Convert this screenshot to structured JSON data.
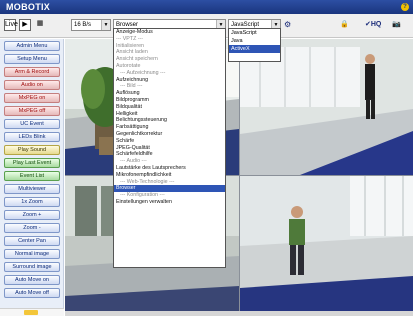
{
  "app": {
    "brand": "MOBOTIX",
    "help_icon": "help-icon",
    "help_glyph": "?"
  },
  "toolbar": {
    "live_label": "Live",
    "play_label": "▶",
    "grid_label": "▦",
    "fps_value": "16 B/s",
    "mode_value": "Browser",
    "script_value": "JavaScript",
    "lock_icon": "lock-icon",
    "lock_glyph": "🔒",
    "vhq_label": "✔HQ",
    "camera_icon": "camera-icon",
    "camera_glyph": "📷",
    "settings_glyph": "⚙"
  },
  "sidebar": {
    "buttons": [
      {
        "label": "Admin Menu",
        "style": "blue"
      },
      {
        "label": "Setup Menu",
        "style": "blue"
      },
      {
        "label": "Arm & Record",
        "style": "red"
      },
      {
        "label": "Audio on",
        "style": "red"
      },
      {
        "label": "MxPEG on",
        "style": "red"
      },
      {
        "label": "MxPEG off",
        "style": "red"
      },
      {
        "label": "UC Event",
        "style": "blue"
      },
      {
        "label": "LEDs Blink",
        "style": "blue"
      },
      {
        "label": "Play Sound",
        "style": "yellow"
      },
      {
        "label": "Play Last Event",
        "style": "green"
      },
      {
        "label": "Event List",
        "style": "green"
      },
      {
        "label": "Multiviewer",
        "style": "blue"
      },
      {
        "label": "1x Zoom",
        "style": "blue"
      },
      {
        "label": "Zoom +",
        "style": "blue"
      },
      {
        "label": "Zoom -",
        "style": "blue"
      },
      {
        "label": "Center Pan",
        "style": "blue"
      },
      {
        "label": "Normal image",
        "style": "blue"
      },
      {
        "label": "Surround image",
        "style": "blue"
      },
      {
        "label": "Auto Move on",
        "style": "blue"
      },
      {
        "label": "Auto Move off",
        "style": "blue"
      }
    ]
  },
  "mode_dropdown": {
    "items": [
      {
        "label": "Anzeige-Modus",
        "kind": "normal"
      },
      {
        "label": "--- VPTZ ---",
        "kind": "disabled"
      },
      {
        "label": "Initialisieren",
        "kind": "disabled"
      },
      {
        "label": "Ansicht laden",
        "kind": "disabled"
      },
      {
        "label": "Ansicht speichern",
        "kind": "disabled"
      },
      {
        "label": "Autorotate",
        "kind": "disabled"
      },
      {
        "label": "--- Aufzeichnung ---",
        "kind": "disabled indent"
      },
      {
        "label": "Aufzeichnung",
        "kind": "normal"
      },
      {
        "label": "--- Bild ---",
        "kind": "disabled indent"
      },
      {
        "label": "Auflösung",
        "kind": "normal"
      },
      {
        "label": "Bildprogramm",
        "kind": "normal"
      },
      {
        "label": "Bildqualität",
        "kind": "normal"
      },
      {
        "label": "Helligkeit",
        "kind": "normal"
      },
      {
        "label": "Belichtungssteuerung",
        "kind": "normal"
      },
      {
        "label": "Farbsättigung",
        "kind": "normal"
      },
      {
        "label": "Gegenlichtkorrektur",
        "kind": "normal"
      },
      {
        "label": "Schärfe",
        "kind": "normal"
      },
      {
        "label": "JPEG-Qualität",
        "kind": "normal"
      },
      {
        "label": "Schärfefeldhilfe",
        "kind": "normal"
      },
      {
        "label": "--- Audio ---",
        "kind": "disabled indent"
      },
      {
        "label": "Lautstärke des Lautsprechers",
        "kind": "normal"
      },
      {
        "label": "Mikrofonempfindlichkeit",
        "kind": "normal"
      },
      {
        "label": "--- Web-Technologie ---",
        "kind": "disabled indent"
      },
      {
        "label": "Browser",
        "kind": "selected"
      },
      {
        "label": "--- Konfiguration ---",
        "kind": "disabled indent"
      },
      {
        "label": "Einstellungen verwalten",
        "kind": "normal"
      }
    ]
  },
  "script_dropdown": {
    "items": [
      {
        "label": "JavaScript",
        "selected": false
      },
      {
        "label": "Java",
        "selected": false
      },
      {
        "label": "ActiveX",
        "selected": true
      }
    ]
  },
  "colors": {
    "accent": "#1a357e",
    "selection": "#2e55b5",
    "wall": "#d7ddd8",
    "carpet": "#2f3f8a"
  }
}
